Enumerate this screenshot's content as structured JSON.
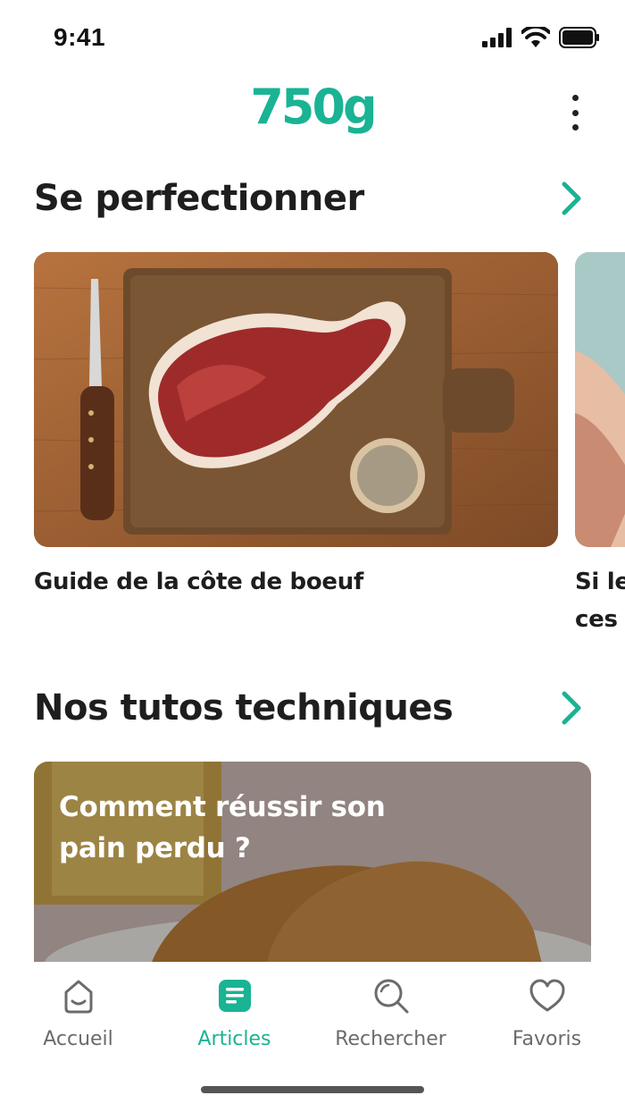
{
  "status_bar": {
    "time": "9:41"
  },
  "header": {
    "logo": "750g"
  },
  "sections": [
    {
      "title": "Se perfectionner"
    },
    {
      "title": "Nos tutos techniques"
    }
  ],
  "carousel": {
    "cards": [
      {
        "caption": "Guide de la côte de boeuf"
      },
      {
        "caption": "Si le\nces"
      }
    ]
  },
  "tuto": {
    "title": "Comment réussir son pain perdu ?"
  },
  "tabs": [
    {
      "label": "Accueil",
      "icon": "home-icon",
      "active": false
    },
    {
      "label": "Articles",
      "icon": "articles-icon",
      "active": true
    },
    {
      "label": "Rechercher",
      "icon": "search-icon",
      "active": false
    },
    {
      "label": "Favoris",
      "icon": "heart-icon",
      "active": false
    }
  ],
  "colors": {
    "accent": "#1ab394",
    "text": "#1e1e1e",
    "muted": "#6b6b6b"
  }
}
